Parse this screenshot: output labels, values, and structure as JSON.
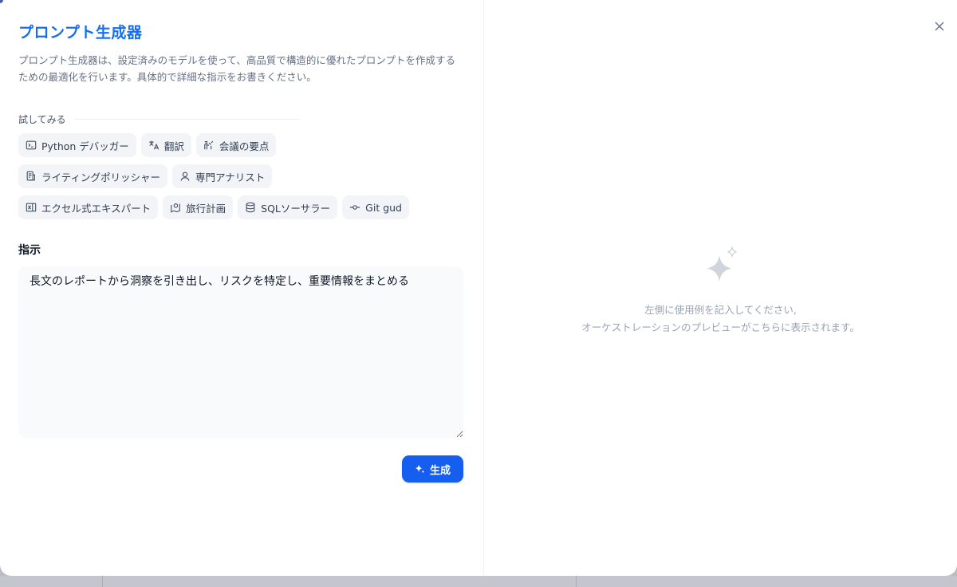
{
  "header": {
    "title": "プロンプト生成器",
    "description": "プロンプト生成器は、設定済みのモデルを使って、高品質で構造的に優れたプロンプトを作成するための最適化を行います。具体的で詳細な指示をお書きください。"
  },
  "try_section": {
    "label": "試してみる",
    "chips": [
      {
        "label": "Python デバッガー",
        "icon": "terminal-icon"
      },
      {
        "label": "翻訳",
        "icon": "translate-icon"
      },
      {
        "label": "会議の要点",
        "icon": "meeting-icon"
      },
      {
        "label": "ライティングポリッシャー",
        "icon": "document-icon"
      },
      {
        "label": "専門アナリスト",
        "icon": "user-icon"
      },
      {
        "label": "エクセル式エキスパート",
        "icon": "excel-icon"
      },
      {
        "label": "旅行計画",
        "icon": "map-icon"
      },
      {
        "label": "SQLソーサラー",
        "icon": "database-icon"
      },
      {
        "label": "Git gud",
        "icon": "git-commit-icon"
      }
    ]
  },
  "instruction": {
    "label": "指示",
    "value": "長文のレポートから洞察を引き出し、リスクを特定し、重要情報をまとめる"
  },
  "generate_button": {
    "label": "生成",
    "icon": "sparkle-icon"
  },
  "preview": {
    "icon": "sparkles-icon",
    "line1": "左側に使用例を記入してください,",
    "line2": "オーケストレーションのプレビューがこちらに表示されます。"
  },
  "colors": {
    "accent": "#155eef",
    "title": "#1570ef",
    "chip_bg": "#f2f4f7",
    "muted_text": "#98a2b3"
  }
}
